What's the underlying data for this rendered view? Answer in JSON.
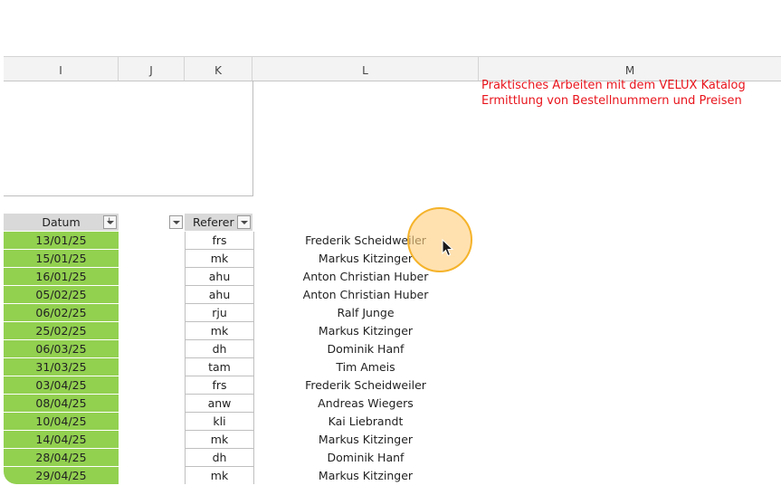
{
  "columns": [
    "I",
    "J",
    "K",
    "L",
    "M"
  ],
  "title_lines": [
    "Praktisches Arbeiten mit dem VELUX Katalog",
    "Ermittlung von Bestellnummern und Preisen"
  ],
  "table": {
    "headers": {
      "datum": "Datum",
      "referent": "Referer"
    },
    "rows": [
      {
        "datum": "13/01/25",
        "ref": "frs",
        "name": "Frederik Scheidweiler"
      },
      {
        "datum": "15/01/25",
        "ref": "mk",
        "name": "Markus Kitzinger"
      },
      {
        "datum": "16/01/25",
        "ref": "ahu",
        "name": "Anton Christian Huber"
      },
      {
        "datum": "05/02/25",
        "ref": "ahu",
        "name": "Anton Christian Huber"
      },
      {
        "datum": "06/02/25",
        "ref": "rju",
        "name": "Ralf Junge"
      },
      {
        "datum": "25/02/25",
        "ref": "mk",
        "name": "Markus Kitzinger"
      },
      {
        "datum": "06/03/25",
        "ref": "dh",
        "name": "Dominik Hanf"
      },
      {
        "datum": "31/03/25",
        "ref": "tam",
        "name": "Tim Ameis"
      },
      {
        "datum": "03/04/25",
        "ref": "frs",
        "name": "Frederik Scheidweiler"
      },
      {
        "datum": "08/04/25",
        "ref": "anw",
        "name": "Andreas Wiegers"
      },
      {
        "datum": "10/04/25",
        "ref": "kli",
        "name": "Kai Liebrandt"
      },
      {
        "datum": "14/04/25",
        "ref": "mk",
        "name": "Markus Kitzinger"
      },
      {
        "datum": "28/04/25",
        "ref": "dh",
        "name": "Dominik Hanf"
      },
      {
        "datum": "29/04/25",
        "ref": "mk",
        "name": "Markus Kitzinger"
      }
    ]
  },
  "colors": {
    "date_fill": "#92d050",
    "title_red": "#e8141c",
    "cursor_halo": "#f5b32a"
  },
  "icons": [
    "sort-filter-icon",
    "dropdown-arrow-icon",
    "mouse-pointer-icon"
  ]
}
